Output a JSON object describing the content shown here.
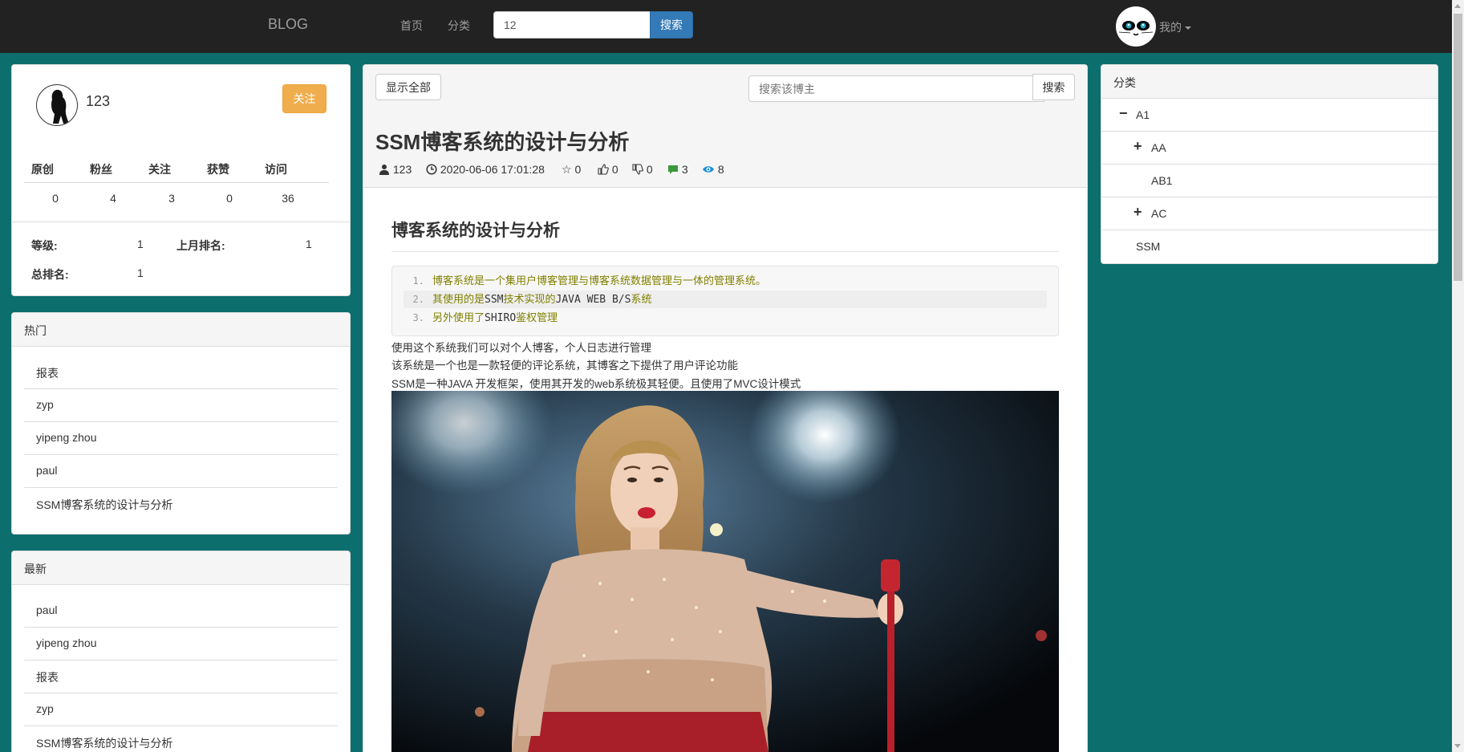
{
  "navbar": {
    "brand": "BLOG",
    "home": "首页",
    "category": "分类",
    "search_value": "12",
    "search_button": "搜索",
    "user_menu": "我的"
  },
  "profile": {
    "name": "123",
    "follow_button": "关注",
    "stats": [
      {
        "label": "原创",
        "value": "0"
      },
      {
        "label": "粉丝",
        "value": "4"
      },
      {
        "label": "关注",
        "value": "3"
      },
      {
        "label": "获赞",
        "value": "0"
      },
      {
        "label": "访问",
        "value": "36"
      }
    ],
    "level_label": "等级:",
    "level_value": "1",
    "last_month_rank_label": "上月排名:",
    "last_month_rank_value": "1",
    "total_rank_label": "总排名:",
    "total_rank_value": "1"
  },
  "hot": {
    "heading": "热门",
    "items": [
      "报表",
      "zyp",
      "yipeng zhou",
      "paul",
      "SSM博客系统的设计与分析"
    ]
  },
  "latest": {
    "heading": "最新",
    "items": [
      "paul",
      "yipeng zhou",
      "报表",
      "zyp",
      "SSM博客系统的设计与分析"
    ]
  },
  "article": {
    "show_all_button": "显示全部",
    "blogger_search_placeholder": "搜索该博主",
    "blogger_search_button": "搜索",
    "title": "SSM博客系统的设计与分析",
    "meta": {
      "author": "123",
      "datetime": "2020-06-06 17:01:28",
      "stars": "0",
      "likes": "0",
      "dislikes": "0",
      "comments": "3",
      "views": "8"
    },
    "content_title": "博客系统的设计与分析",
    "code_lines": [
      {
        "num": "1.",
        "parts": [
          {
            "t": "博客系统是一个集用户博客管理与博客系统数据管理与一体的管理系统。",
            "mono": false
          }
        ]
      },
      {
        "num": "2.",
        "parts": [
          {
            "t": "其使用的是",
            "mono": false
          },
          {
            "t": "SSM",
            "mono": true
          },
          {
            "t": "技术实现的",
            "mono": false
          },
          {
            "t": "JAVA WEB B/S",
            "mono": true
          },
          {
            "t": "系统",
            "mono": false
          }
        ]
      },
      {
        "num": "3.",
        "parts": [
          {
            "t": "另外使用了",
            "mono": false
          },
          {
            "t": "SHIRO",
            "mono": true
          },
          {
            "t": "鉴权管理",
            "mono": false
          }
        ]
      }
    ],
    "paragraphs": [
      "使用这个系统我们可以对个人博客，个人日志进行管理",
      "该系统是一个也是一款轻便的评论系统，其博客之下提供了用户评论功能",
      "SSM是一种JAVA 开发框架，使用其开发的web系统极其轻便。且使用了MVC设计模式"
    ]
  },
  "categories": {
    "heading": "分类",
    "items": [
      {
        "sign": "−",
        "label": "A1",
        "level": 0
      },
      {
        "sign": "+",
        "label": "AA",
        "level": 1
      },
      {
        "sign": "",
        "label": "AB1",
        "level": 1
      },
      {
        "sign": "+",
        "label": "AC",
        "level": 1
      },
      {
        "sign": "",
        "label": "SSM",
        "level": 0
      }
    ]
  },
  "colors": {
    "background": "#0d6e6e",
    "navbar": "#222222",
    "primary": "#337ab7",
    "warning": "#f0ad4e",
    "comment_icon": "#3c9a3c",
    "view_icon": "#1e8fd6"
  }
}
